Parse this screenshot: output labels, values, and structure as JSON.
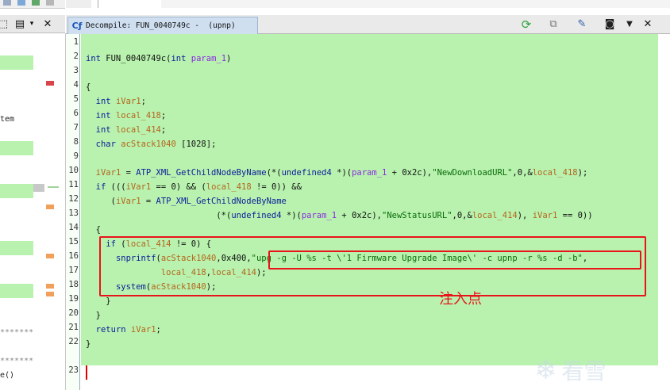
{
  "window": {
    "title": "Decompile: FUN_0040749c -  (upnp)"
  },
  "listing": {
    "fragments": [
      "tem",
      "*******",
      "*******",
      "e()"
    ]
  },
  "code": {
    "line_numbers": [
      "1",
      "2",
      "3",
      "4",
      "5",
      "6",
      "7",
      "8",
      "9",
      "10",
      "11",
      "12",
      "13",
      "14",
      "15",
      "16",
      "17",
      "18",
      "19",
      "20",
      "21",
      "22",
      "23"
    ]
  },
  "annotation": {
    "label": "注入点"
  },
  "watermark": {
    "text": "看雪"
  },
  "colors": {
    "code_background": "#b8f2ae",
    "highlight": "#e8141a",
    "keyword": "#0b1a9a",
    "variable": "#b5651d",
    "string": "#0a6b0a"
  },
  "icons": [
    "refresh-icon",
    "copy-icon",
    "edit-icon",
    "snapshot-icon",
    "menu-dropdown-icon",
    "close-icon"
  ]
}
